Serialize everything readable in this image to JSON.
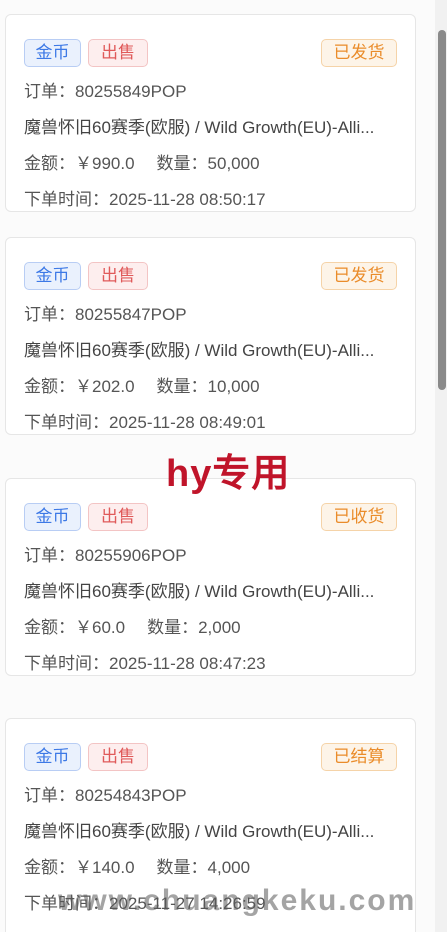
{
  "orders": [
    {
      "tag_type": "金币",
      "tag_action": "出售",
      "status": "已发货",
      "order_label": "订单：",
      "order_no": "80255849POP",
      "product": "魔兽怀旧60赛季(欧服) / Wild Growth(EU)-Alli...",
      "amount_label": "金额：",
      "amount": "￥990.0",
      "qty_label": "数量：",
      "qty": "50,000",
      "time_label": "下单时间：",
      "time": "2025-11-28 08:50:17"
    },
    {
      "tag_type": "金币",
      "tag_action": "出售",
      "status": "已发货",
      "order_label": "订单：",
      "order_no": "80255847POP",
      "product": "魔兽怀旧60赛季(欧服) / Wild Growth(EU)-Alli...",
      "amount_label": "金额：",
      "amount": "￥202.0",
      "qty_label": "数量：",
      "qty": "10,000",
      "time_label": "下单时间：",
      "time": "2025-11-28 08:49:01"
    },
    {
      "tag_type": "金币",
      "tag_action": "出售",
      "status": "已收货",
      "order_label": "订单：",
      "order_no": "80255906POP",
      "product": "魔兽怀旧60赛季(欧服) / Wild Growth(EU)-Alli...",
      "amount_label": "金额：",
      "amount": "￥60.0",
      "qty_label": "数量：",
      "qty": "2,000",
      "time_label": "下单时间：",
      "time": "2025-11-28 08:47:23"
    },
    {
      "tag_type": "金币",
      "tag_action": "出售",
      "status": "已结算",
      "order_label": "订单：",
      "order_no": "80254843POP",
      "product": "魔兽怀旧60赛季(欧服) / Wild Growth(EU)-Alli...",
      "amount_label": "金额：",
      "amount": "￥140.0",
      "qty_label": "数量：",
      "qty": "4,000",
      "time_label": "下单时间：",
      "time": "2025-11-27 14:26:59"
    }
  ],
  "watermarks": {
    "center": "hy专用",
    "bottom": "www.chuangkeku.com"
  },
  "colors": {
    "tag_coin": "#3d79e6",
    "tag_sell": "#e05a5a",
    "tag_status": "#ea8c2a",
    "watermark_center": "#c0142a"
  }
}
